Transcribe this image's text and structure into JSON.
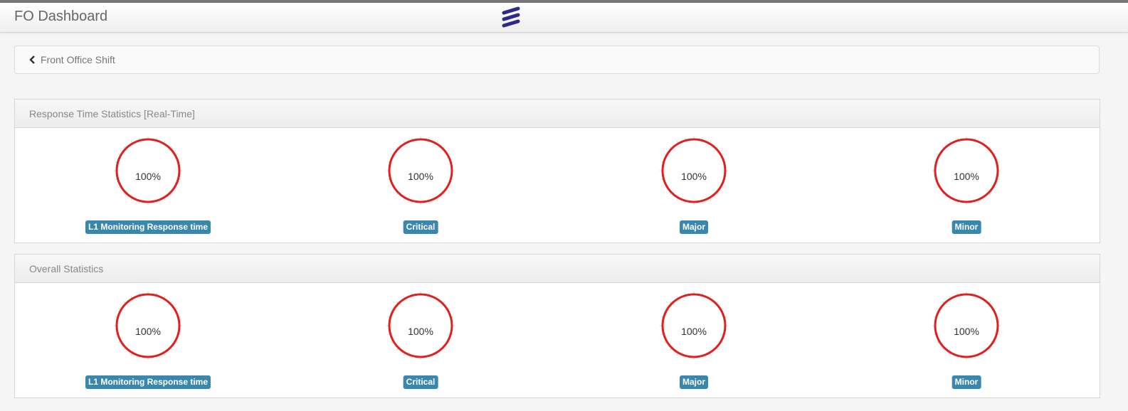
{
  "header": {
    "title": "FO Dashboard",
    "logo_icon": "ericsson-logo-icon",
    "logo_color": "#2e2a8c"
  },
  "breadcrumb": {
    "back_icon": "chevron-left-icon",
    "label": "Front Office Shift"
  },
  "panels": [
    {
      "title": "Response Time Statistics [Real-Time]",
      "gauges": [
        {
          "value": "100%",
          "label": "L1 Monitoring Response time"
        },
        {
          "value": "100%",
          "label": "Critical"
        },
        {
          "value": "100%",
          "label": "Major"
        },
        {
          "value": "100%",
          "label": "Minor"
        }
      ]
    },
    {
      "title": "Overall Statistics",
      "gauges": [
        {
          "value": "100%",
          "label": "L1 Monitoring Response time"
        },
        {
          "value": "100%",
          "label": "Critical"
        },
        {
          "value": "100%",
          "label": "Major"
        },
        {
          "value": "100%",
          "label": "Minor"
        }
      ]
    }
  ],
  "colors": {
    "gauge_ring": "#e0201f",
    "label_badge": "#3a87ad",
    "tick": "#d0d0d0"
  }
}
